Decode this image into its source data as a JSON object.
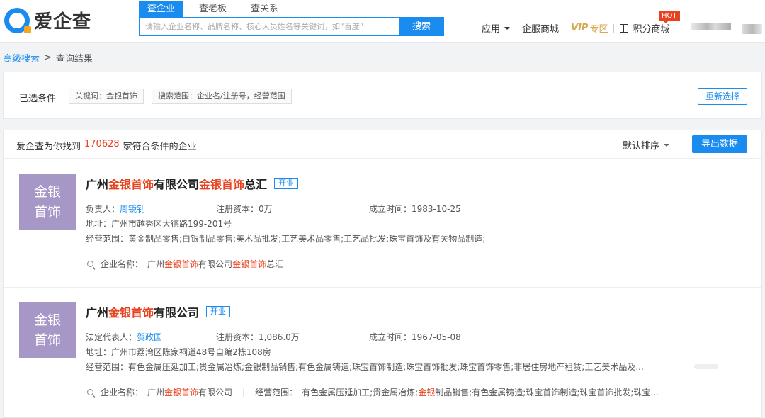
{
  "header": {
    "logo_text": "爱企查",
    "search_tabs": [
      "查企业",
      "查老板",
      "查关系"
    ],
    "search_placeholder": "请输入企业名称、品牌名称、核心人员姓名等关键词，如“百度”",
    "search_button": "搜索",
    "nav": {
      "apps": "应用",
      "enterprise_mall": "企服商城",
      "vip": "VIP",
      "vip_sub": "专区",
      "points_mall": "积分商城",
      "hot_badge": "HOT"
    }
  },
  "breadcrumb": {
    "advanced_search": "高级搜索",
    "separator": ">",
    "current": "查询结果"
  },
  "filters": {
    "label": "已选条件",
    "chips": [
      "关键词：金银首饰",
      "搜索范围：企业名/注册号，经营范围"
    ],
    "reset_button": "重新选择"
  },
  "results": {
    "prefix": "爱企查为你找到",
    "count": "170628",
    "suffix": "家符合条件的企业",
    "sort_label": "默认排序",
    "export_button": "导出数据",
    "items": [
      {
        "logo_line1": "金银",
        "logo_line2": "首饰",
        "name_parts": [
          "广州",
          "金银首饰",
          "有限公司",
          "金银首饰",
          "总汇"
        ],
        "status": "开业",
        "rep_label": "负责人：",
        "rep_name": "周镜钊",
        "capital": "注册资本：0万",
        "established": "成立时间：1983-10-25",
        "address": "地址：广州市越秀区大德路199-201号",
        "scope": "经营范围：黄金制品零售;白银制品零售;美术品批发;工艺美术品零售;工艺品批发;珠宝首饰及有关物品制造;",
        "match_label": "企业名称：",
        "match_parts": [
          "广州",
          "金银首饰",
          "有限公司",
          "金银首饰",
          "总汇"
        ]
      },
      {
        "logo_line1": "金银",
        "logo_line2": "首饰",
        "name_parts": [
          "广州",
          "金银首饰",
          "有限公司"
        ],
        "status": "开业",
        "rep_label": "法定代表人：",
        "rep_name": "贺政国",
        "capital": "注册资本：1,086.0万",
        "established": "成立时间：1967-05-08",
        "address": "地址：广州市荔湾区陈家祠道48号自编2栋108房",
        "scope": "经营范围：有色金属压延加工;贵金属冶炼;金银制品销售;有色金属铸造;珠宝首饰制造;珠宝首饰批发;珠宝首饰零售;非居住房地产租赁;工艺美术品及...",
        "match_label": "企业名称：",
        "match_parts": [
          "广州",
          "金银首饰",
          "有限公司"
        ],
        "match_scope_label": "经营范围：",
        "match_scope_parts": [
          "有色金属压延加工;贵金属冶炼;",
          "金银",
          "制品销售;有色金属铸造;珠宝首饰制造;珠宝首饰批发;珠宝..."
        ]
      }
    ]
  }
}
